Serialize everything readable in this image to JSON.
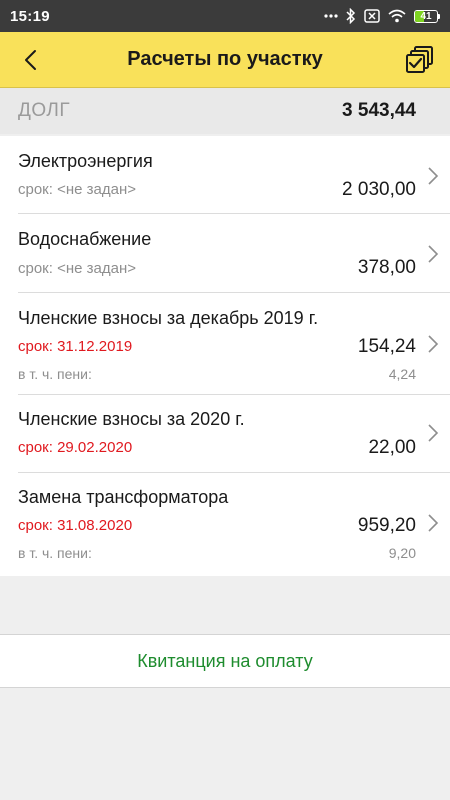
{
  "status_bar": {
    "time": "15:19",
    "battery_level": "41",
    "icons": [
      "dots-icon",
      "bluetooth-icon",
      "sim-x-icon",
      "wifi-icon",
      "battery-icon"
    ]
  },
  "app_bar": {
    "title": "Расчеты по участку",
    "back_icon": "chevron-left-icon",
    "action_icon": "checklist-icon",
    "color": "#f9e15a"
  },
  "debt": {
    "label": "ДОЛГ",
    "value": "3 543,44"
  },
  "items": [
    {
      "title": "Электроэнергия",
      "term": "срок: <не задан>",
      "term_overdue": false,
      "amount": "2 030,00"
    },
    {
      "title": "Водоснабжение",
      "term": "срок: <не задан>",
      "term_overdue": false,
      "amount": "378,00"
    },
    {
      "title": "Членские взносы за декабрь 2019 г.",
      "term": "срок: 31.12.2019",
      "term_overdue": true,
      "amount": "154,24",
      "penalty_label": "в т. ч. пени:",
      "penalty_value": "4,24"
    },
    {
      "title": "Членские взносы за 2020 г.",
      "term": "срок: 29.02.2020",
      "term_overdue": true,
      "amount": "22,00"
    },
    {
      "title": "Замена трансформатора",
      "term": "срок: 31.08.2020",
      "term_overdue": true,
      "amount": "959,20",
      "penalty_label": "в т. ч. пени:",
      "penalty_value": "9,20"
    }
  ],
  "receipt_button": {
    "label": "Квитанция на оплату",
    "color": "#1e8c2e"
  },
  "colors": {
    "overdue": "#e0191f",
    "muted": "#8e8e8e"
  }
}
